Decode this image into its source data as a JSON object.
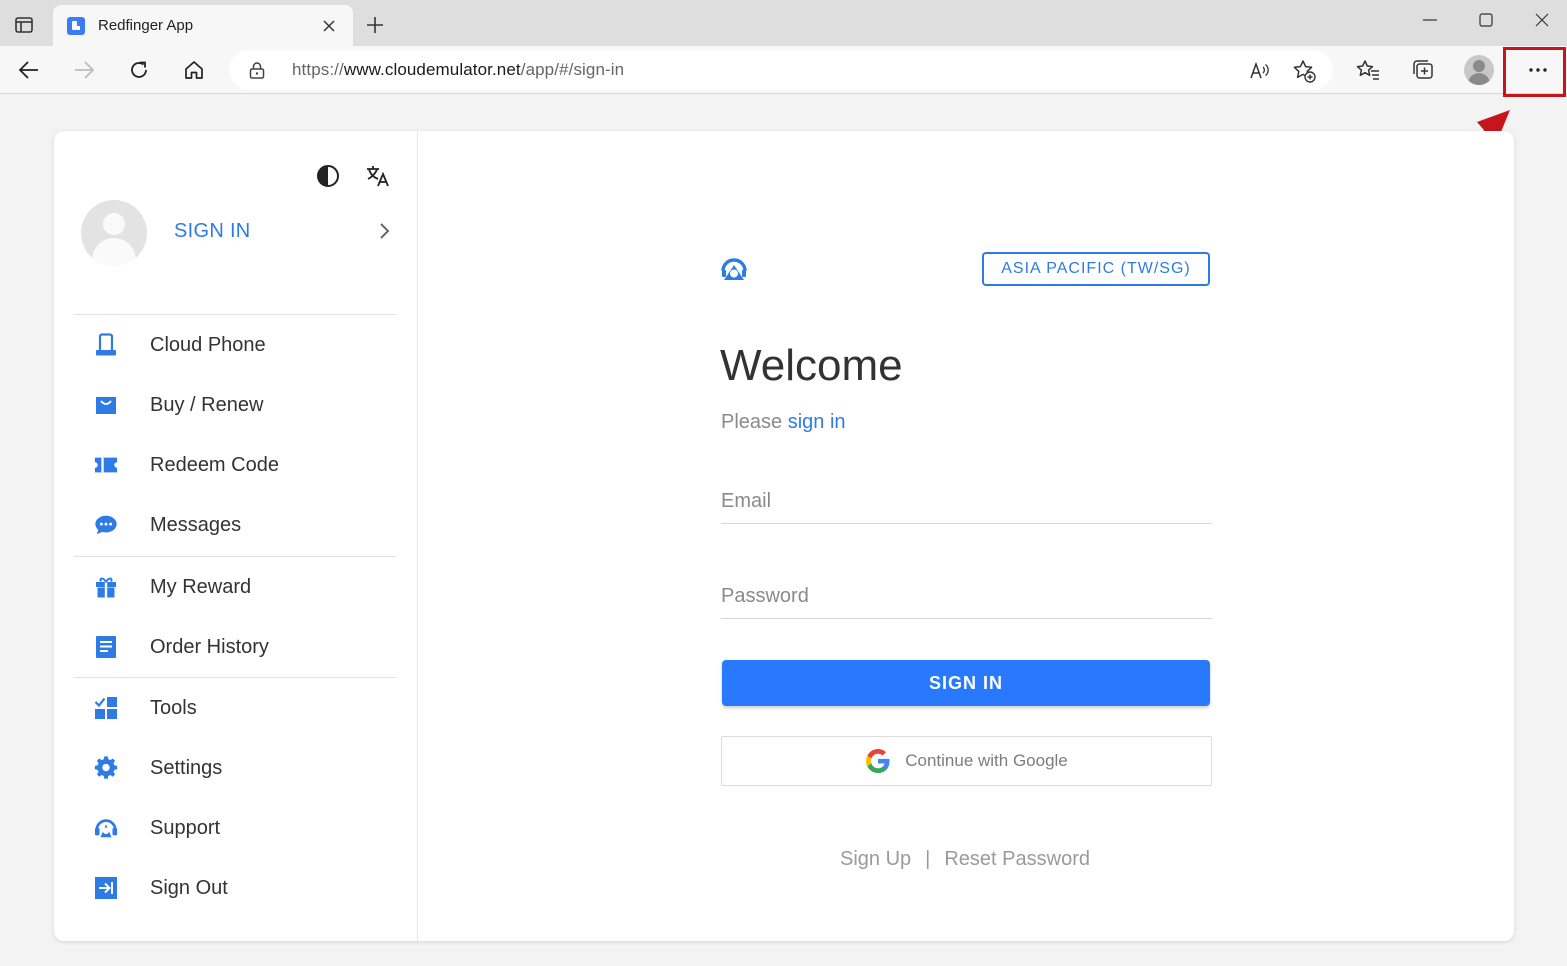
{
  "browser": {
    "tab_title": "Redfinger App",
    "url_prefix": "https://",
    "url_host": "www.cloudemulator.net",
    "url_path": "/app/#/sign-in"
  },
  "sidebar": {
    "sign_in_label": "SIGN IN",
    "items": [
      {
        "label": "Cloud Phone",
        "icon": "phone-icon"
      },
      {
        "label": "Buy / Renew",
        "icon": "shopping-bag-icon"
      },
      {
        "label": "Redeem Code",
        "icon": "ticket-icon"
      },
      {
        "label": "Messages",
        "icon": "chat-bubble-icon"
      },
      {
        "label": "My Reward",
        "icon": "gift-icon"
      },
      {
        "label": "Order History",
        "icon": "receipt-icon"
      },
      {
        "label": "Tools",
        "icon": "tools-grid-icon"
      },
      {
        "label": "Settings",
        "icon": "gear-icon"
      },
      {
        "label": "Support",
        "icon": "support-agent-icon"
      },
      {
        "label": "Sign Out",
        "icon": "sign-out-icon"
      }
    ]
  },
  "form": {
    "region": "ASIA PACIFIC (TW/SG)",
    "title": "Welcome",
    "subtitle_prefix": "Please ",
    "subtitle_link": "sign in",
    "email_placeholder": "Email",
    "password_placeholder": "Password",
    "sign_in_button": "SIGN IN",
    "google_button": "Continue with Google",
    "sign_up": "Sign Up",
    "separator": "|",
    "reset_password": "Reset Password"
  },
  "colors": {
    "accent": "#2979ff",
    "link": "#2f7be5",
    "annotation": "#c4161c"
  }
}
